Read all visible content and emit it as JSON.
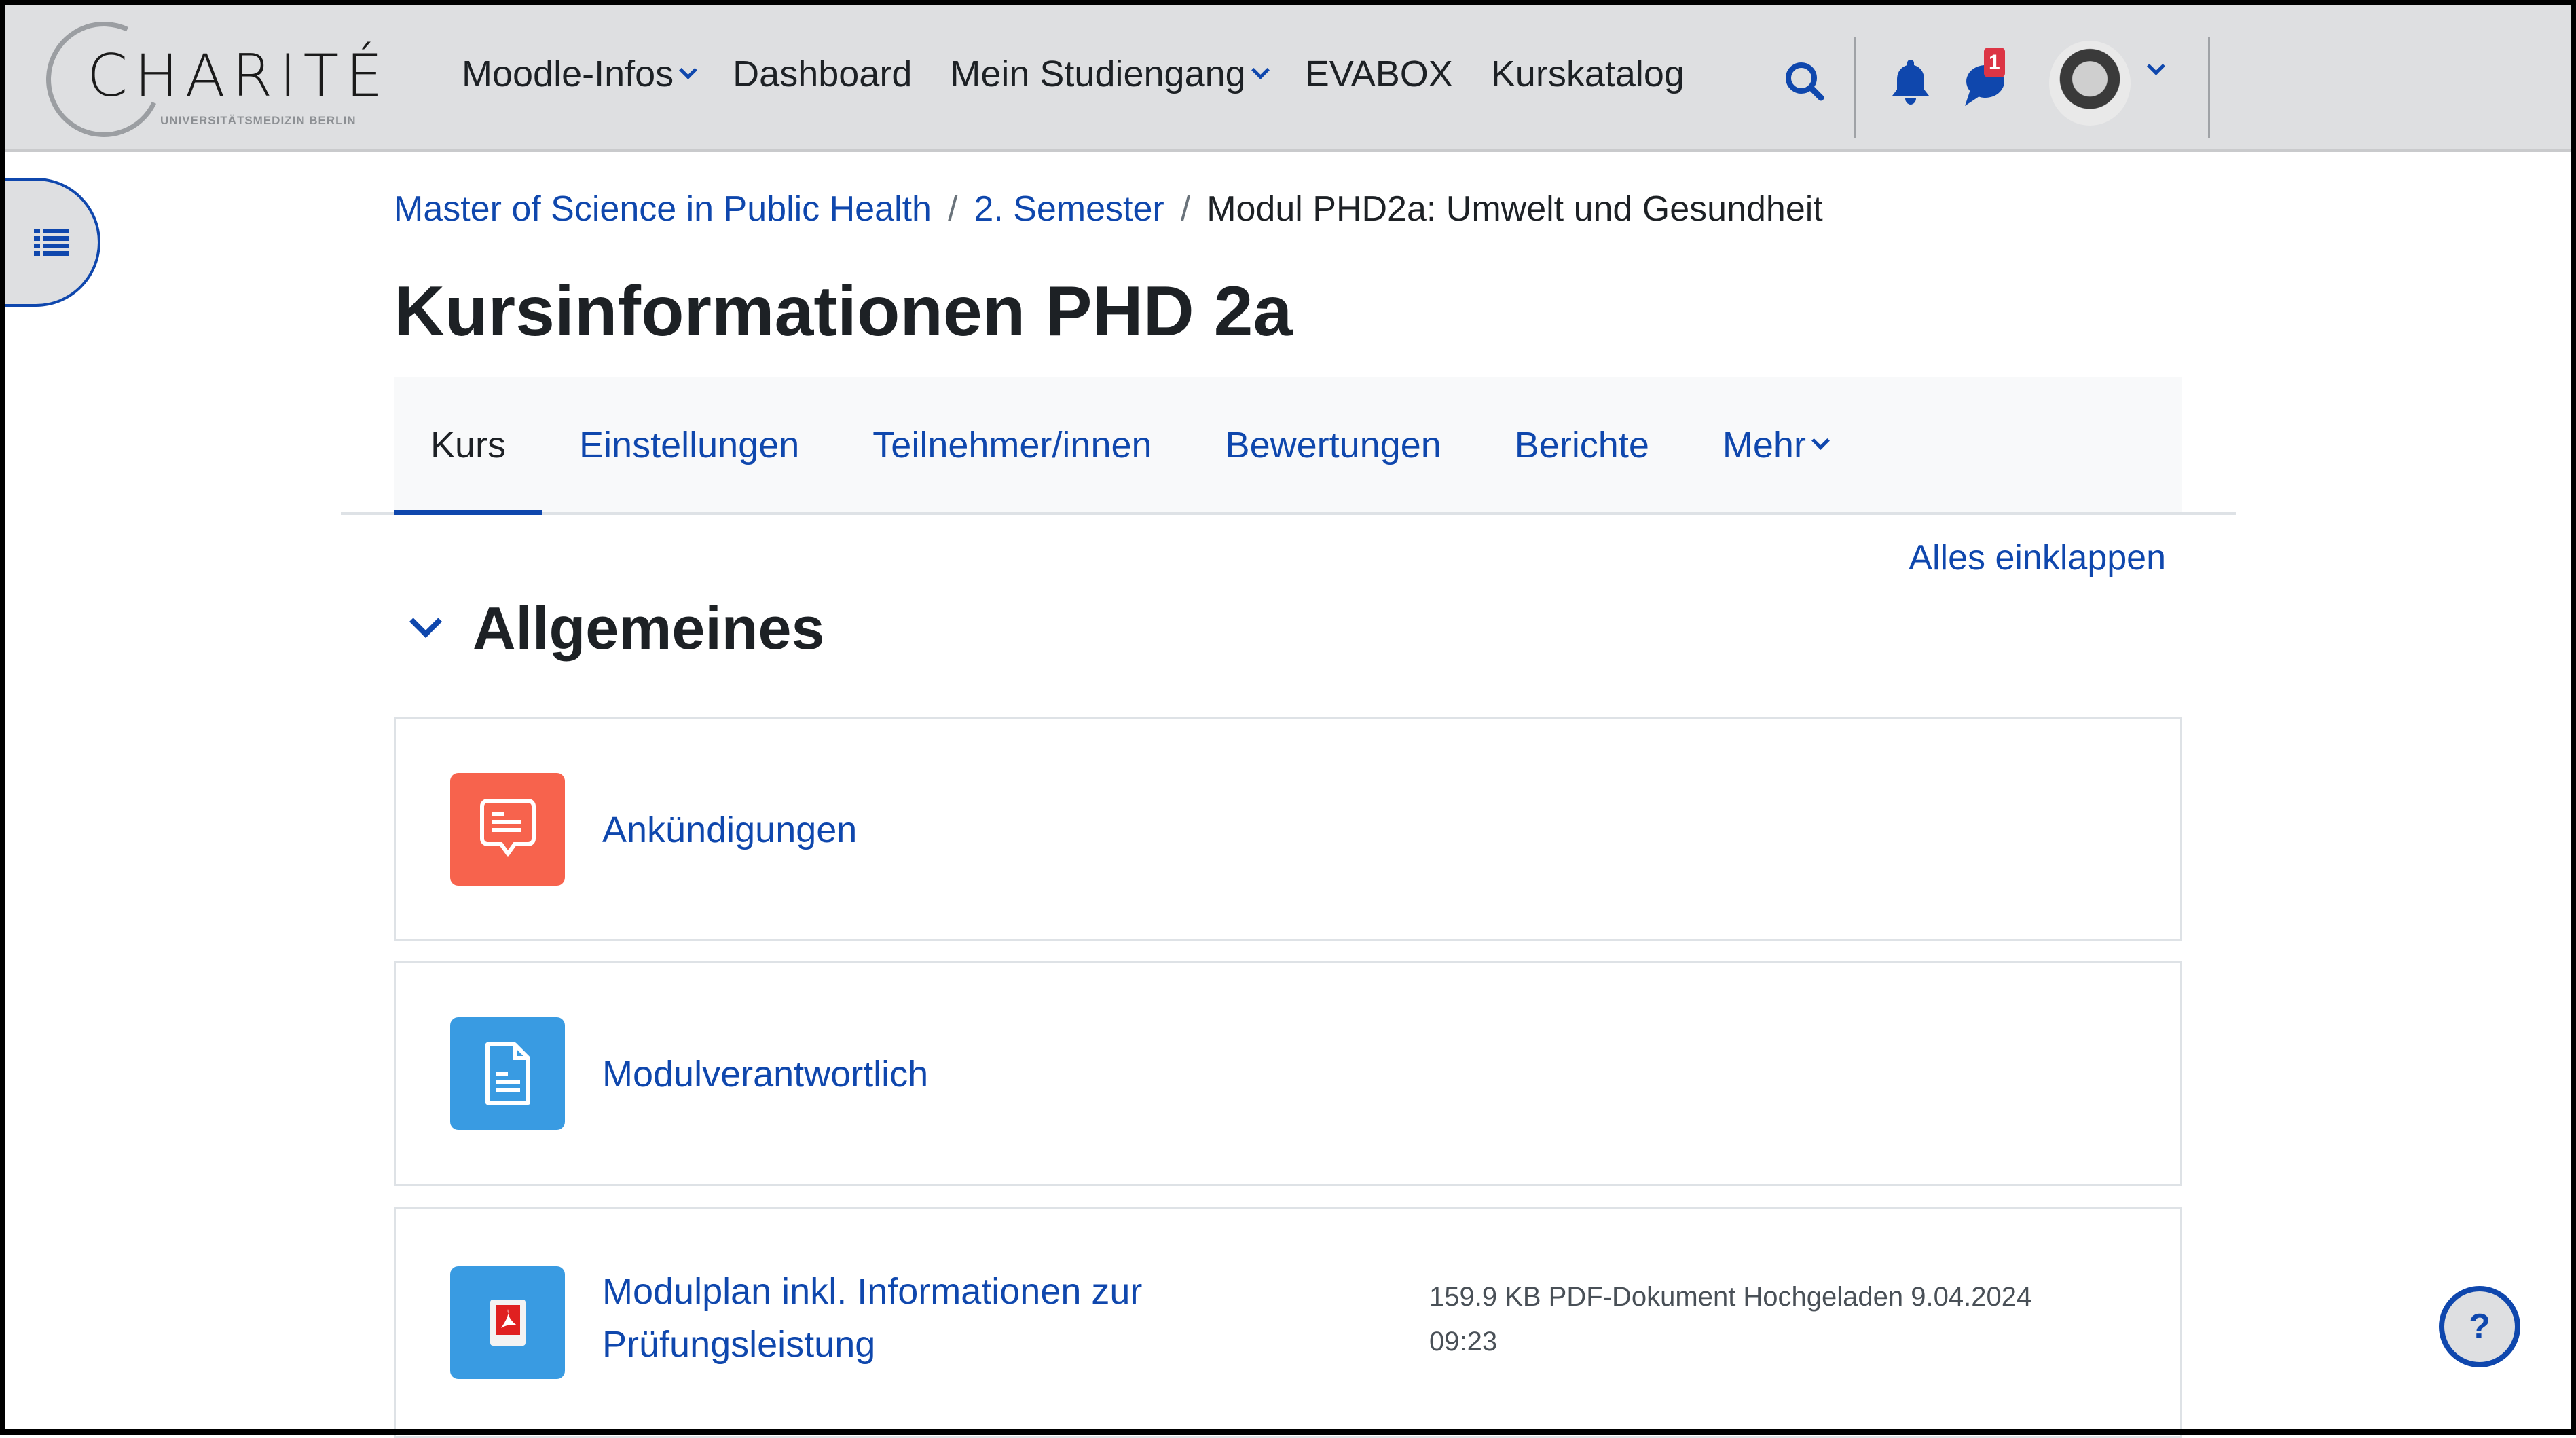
{
  "header": {
    "logo": {
      "name": "CHARITÉ",
      "subtitle": "UNIVERSITÄTSMEDIZIN BERLIN"
    },
    "nav": [
      {
        "label": "Moodle-Infos",
        "dropdown": true
      },
      {
        "label": "Dashboard",
        "dropdown": false
      },
      {
        "label": "Mein Studiengang",
        "dropdown": true
      },
      {
        "label": "EVABOX",
        "dropdown": false
      },
      {
        "label": "Kurskatalog",
        "dropdown": false
      }
    ],
    "icons": {
      "search": "search-icon",
      "notifications": "bell-icon",
      "messages": "chat-icon",
      "user_menu": "chevron-down-icon"
    },
    "message_badge": "1"
  },
  "breadcrumb": {
    "items": [
      {
        "label": "Master of Science in Public Health",
        "link": true
      },
      {
        "label": "2. Semester",
        "link": true
      },
      {
        "label": "Modul PHD2a: Umwelt und Gesundheit",
        "link": false
      }
    ],
    "separator": "/"
  },
  "page_title": "Kursinformationen PHD 2a",
  "tabs": [
    {
      "label": "Kurs",
      "active": true
    },
    {
      "label": "Einstellungen",
      "active": false
    },
    {
      "label": "Teilnehmer/innen",
      "active": false
    },
    {
      "label": "Bewertungen",
      "active": false
    },
    {
      "label": "Berichte",
      "active": false
    },
    {
      "label": "Mehr",
      "active": false,
      "dropdown": true
    }
  ],
  "collapse_all_label": "Alles einklappen",
  "section": {
    "title": "Allgemeines",
    "activities": [
      {
        "name": "Ankündigungen",
        "type": "forum",
        "icon": "announcement-icon",
        "color": "#f7634d",
        "meta": ""
      },
      {
        "name": "Modulverantwortlich",
        "type": "page",
        "icon": "document-icon",
        "color": "#399be2",
        "meta": ""
      },
      {
        "name_line1": "Modulplan inkl. Informationen zur",
        "name_line2": "Prüfungsleistung",
        "type": "file",
        "icon": "pdf-icon",
        "color": "#399be2",
        "meta_line1": "159.9 KB PDF-Dokument Hochgeladen 9.04.2024",
        "meta_line2": "09:23"
      }
    ]
  },
  "help_button_label": "?",
  "colors": {
    "primary": "#0f47ad",
    "header_bg": "#dedfe1",
    "badge": "#dc3545",
    "text": "#1d2125"
  }
}
